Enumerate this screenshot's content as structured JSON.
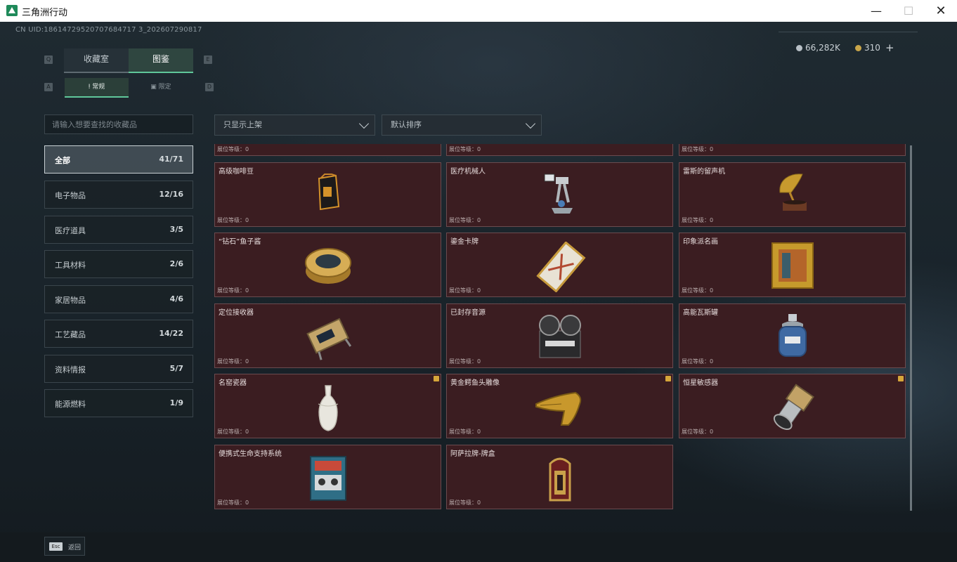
{
  "window": {
    "title": "三角洲行动",
    "min": "—",
    "max": "☐",
    "close": "✕"
  },
  "uid": "CN UID:18614729520707684717 3_202607290817",
  "currency": {
    "silver": "66,282K",
    "gold": "310",
    "plus": "+"
  },
  "keys": {
    "q": "Q",
    "e": "E",
    "a": "A",
    "d": "D",
    "esc": "Esc"
  },
  "tabs": {
    "collection_room": "收藏室",
    "catalog": "图鉴"
  },
  "subtabs": {
    "regular": "常规",
    "limited": "限定"
  },
  "search": {
    "placeholder": "请输入想要查找的收藏品"
  },
  "filters": {
    "shelf": "只显示上架",
    "sort": "默认排序"
  },
  "categories": [
    {
      "name": "全部",
      "count": "41/71"
    },
    {
      "name": "电子物品",
      "count": "12/16"
    },
    {
      "name": "医疗道具",
      "count": "3/5"
    },
    {
      "name": "工具材料",
      "count": "2/6"
    },
    {
      "name": "家居物品",
      "count": "4/6"
    },
    {
      "name": "工艺藏品",
      "count": "14/22"
    },
    {
      "name": "资料情报",
      "count": "5/7"
    },
    {
      "name": "能源燃料",
      "count": "1/9"
    }
  ],
  "level_label": "展位等级：0",
  "items": [
    {
      "name": "",
      "icon": "item-partial-icon"
    },
    {
      "name": "",
      "icon": "item-partial-icon"
    },
    {
      "name": "",
      "icon": "item-partial-icon"
    },
    {
      "name": "高级咖啡豆",
      "icon": "coffee-bag-icon"
    },
    {
      "name": "医疗机械人",
      "icon": "medical-robot-icon"
    },
    {
      "name": "雷斯的留声机",
      "icon": "gramophone-icon"
    },
    {
      "name": "“钻石”鱼子酱",
      "icon": "caviar-tin-icon"
    },
    {
      "name": "鎏金卡牌",
      "icon": "gold-card-icon"
    },
    {
      "name": "印象派名画",
      "icon": "painting-icon"
    },
    {
      "name": "定位接收器",
      "icon": "receiver-icon"
    },
    {
      "name": "已封存音源",
      "icon": "reel-recorder-icon"
    },
    {
      "name": "高能瓦斯罐",
      "icon": "gas-canister-icon"
    },
    {
      "name": "名窑瓷器",
      "icon": "porcelain-vase-icon",
      "warn": true
    },
    {
      "name": "黄金鳄鱼头雕像",
      "icon": "gold-crocodile-icon",
      "warn": true
    },
    {
      "name": "恒星敏感器",
      "icon": "star-sensor-icon",
      "warn": true
    },
    {
      "name": "便携式生命支持系统",
      "icon": "life-support-icon"
    },
    {
      "name": "阿萨拉牌-牌盒",
      "icon": "card-box-icon"
    }
  ],
  "footer": {
    "back": "返回"
  }
}
